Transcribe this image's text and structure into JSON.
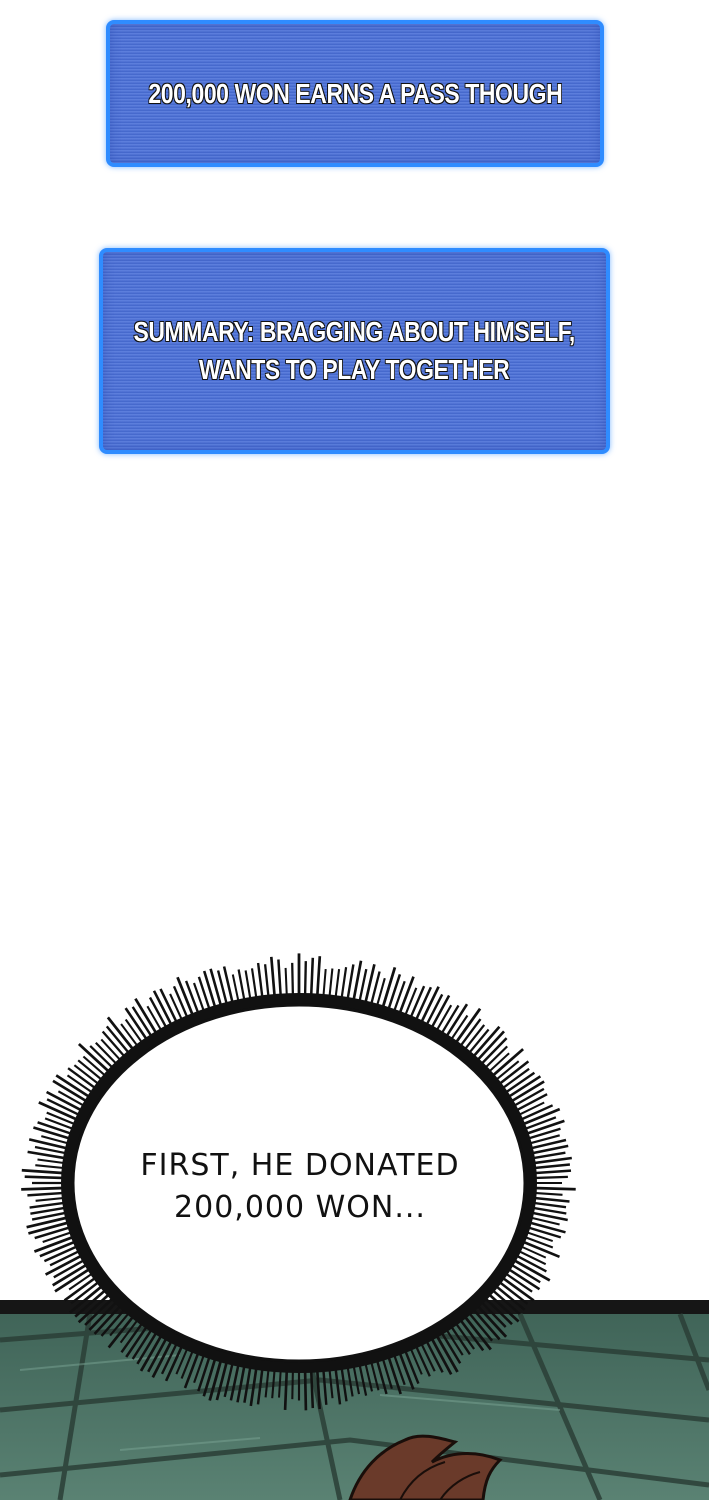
{
  "panels": [
    {
      "id": "box1",
      "lines": [
        "200,000 WON EARNS A PASS THOUGH"
      ]
    },
    {
      "id": "box2",
      "lines": [
        "SUMMARY: BRAGGING ABOUT HIMSELF,",
        "WANTS TO PLAY TOGETHER"
      ]
    }
  ],
  "speech_bubble": {
    "lines": [
      "FIRST, HE DONATED",
      "200,000 WON..."
    ]
  },
  "colors": {
    "system_box_fill": "#4a6fd8",
    "system_box_border": "#2f8cff",
    "floor_tile": "#4f7567",
    "floor_grout": "#2b3f37"
  }
}
